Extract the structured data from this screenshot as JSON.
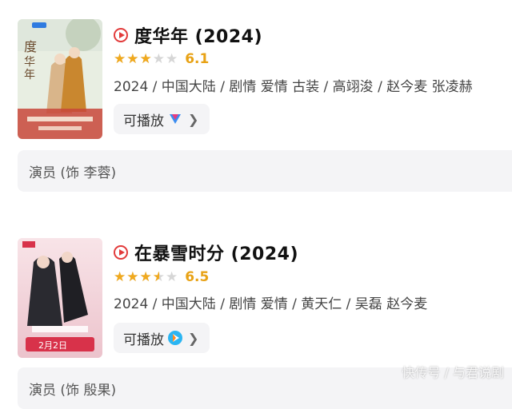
{
  "items": [
    {
      "title": "度华年 (2024)",
      "rating": 3,
      "rating_max": 5,
      "score": "6.1",
      "meta": "2024 / 中国大陆 / 剧情 爱情 古装 / 高翊浚 / 赵今麦 张凌赫",
      "play_label": "可播放",
      "platform_icon": "youku-icon",
      "cast_text": "演员 (饰 李蓉)",
      "poster_colors": [
        "#e9efe3",
        "#c7a57a",
        "#c8443a"
      ]
    },
    {
      "title": "在暴雪时分 (2024)",
      "rating": 3.5,
      "rating_max": 5,
      "score": "6.5",
      "meta": "2024 / 中国大陆 / 剧情 爱情 / 黄天仁 / 吴磊 赵今麦",
      "play_label": "可播放",
      "platform_icon": "tencent-video-icon",
      "cast_text": "演员 (饰 殷果)",
      "poster_colors": [
        "#f3d9df",
        "#2d2d33",
        "#d8324a"
      ]
    }
  ],
  "colors": {
    "accent_red": "#e23a3a",
    "star": "#f0a91e",
    "score": "#e8a215",
    "panel": "#f4f4f6"
  },
  "watermark": "快传号 / 与君说剧"
}
